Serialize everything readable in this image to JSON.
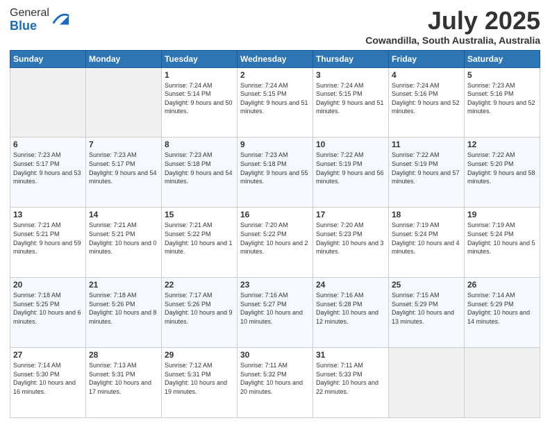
{
  "header": {
    "logo_general": "General",
    "logo_blue": "Blue",
    "main_title": "July 2025",
    "subtitle": "Cowandilla, South Australia, Australia"
  },
  "days_of_week": [
    "Sunday",
    "Monday",
    "Tuesday",
    "Wednesday",
    "Thursday",
    "Friday",
    "Saturday"
  ],
  "weeks": [
    [
      {
        "day": "",
        "info": ""
      },
      {
        "day": "",
        "info": ""
      },
      {
        "day": "1",
        "info": "Sunrise: 7:24 AM\nSunset: 5:14 PM\nDaylight: 9 hours and 50 minutes."
      },
      {
        "day": "2",
        "info": "Sunrise: 7:24 AM\nSunset: 5:15 PM\nDaylight: 9 hours and 51 minutes."
      },
      {
        "day": "3",
        "info": "Sunrise: 7:24 AM\nSunset: 5:15 PM\nDaylight: 9 hours and 51 minutes."
      },
      {
        "day": "4",
        "info": "Sunrise: 7:24 AM\nSunset: 5:16 PM\nDaylight: 9 hours and 52 minutes."
      },
      {
        "day": "5",
        "info": "Sunrise: 7:23 AM\nSunset: 5:16 PM\nDaylight: 9 hours and 52 minutes."
      }
    ],
    [
      {
        "day": "6",
        "info": "Sunrise: 7:23 AM\nSunset: 5:17 PM\nDaylight: 9 hours and 53 minutes."
      },
      {
        "day": "7",
        "info": "Sunrise: 7:23 AM\nSunset: 5:17 PM\nDaylight: 9 hours and 54 minutes."
      },
      {
        "day": "8",
        "info": "Sunrise: 7:23 AM\nSunset: 5:18 PM\nDaylight: 9 hours and 54 minutes."
      },
      {
        "day": "9",
        "info": "Sunrise: 7:23 AM\nSunset: 5:18 PM\nDaylight: 9 hours and 55 minutes."
      },
      {
        "day": "10",
        "info": "Sunrise: 7:22 AM\nSunset: 5:19 PM\nDaylight: 9 hours and 56 minutes."
      },
      {
        "day": "11",
        "info": "Sunrise: 7:22 AM\nSunset: 5:19 PM\nDaylight: 9 hours and 57 minutes."
      },
      {
        "day": "12",
        "info": "Sunrise: 7:22 AM\nSunset: 5:20 PM\nDaylight: 9 hours and 58 minutes."
      }
    ],
    [
      {
        "day": "13",
        "info": "Sunrise: 7:21 AM\nSunset: 5:21 PM\nDaylight: 9 hours and 59 minutes."
      },
      {
        "day": "14",
        "info": "Sunrise: 7:21 AM\nSunset: 5:21 PM\nDaylight: 10 hours and 0 minutes."
      },
      {
        "day": "15",
        "info": "Sunrise: 7:21 AM\nSunset: 5:22 PM\nDaylight: 10 hours and 1 minute."
      },
      {
        "day": "16",
        "info": "Sunrise: 7:20 AM\nSunset: 5:22 PM\nDaylight: 10 hours and 2 minutes."
      },
      {
        "day": "17",
        "info": "Sunrise: 7:20 AM\nSunset: 5:23 PM\nDaylight: 10 hours and 3 minutes."
      },
      {
        "day": "18",
        "info": "Sunrise: 7:19 AM\nSunset: 5:24 PM\nDaylight: 10 hours and 4 minutes."
      },
      {
        "day": "19",
        "info": "Sunrise: 7:19 AM\nSunset: 5:24 PM\nDaylight: 10 hours and 5 minutes."
      }
    ],
    [
      {
        "day": "20",
        "info": "Sunrise: 7:18 AM\nSunset: 5:25 PM\nDaylight: 10 hours and 6 minutes."
      },
      {
        "day": "21",
        "info": "Sunrise: 7:18 AM\nSunset: 5:26 PM\nDaylight: 10 hours and 8 minutes."
      },
      {
        "day": "22",
        "info": "Sunrise: 7:17 AM\nSunset: 5:26 PM\nDaylight: 10 hours and 9 minutes."
      },
      {
        "day": "23",
        "info": "Sunrise: 7:16 AM\nSunset: 5:27 PM\nDaylight: 10 hours and 10 minutes."
      },
      {
        "day": "24",
        "info": "Sunrise: 7:16 AM\nSunset: 5:28 PM\nDaylight: 10 hours and 12 minutes."
      },
      {
        "day": "25",
        "info": "Sunrise: 7:15 AM\nSunset: 5:29 PM\nDaylight: 10 hours and 13 minutes."
      },
      {
        "day": "26",
        "info": "Sunrise: 7:14 AM\nSunset: 5:29 PM\nDaylight: 10 hours and 14 minutes."
      }
    ],
    [
      {
        "day": "27",
        "info": "Sunrise: 7:14 AM\nSunset: 5:30 PM\nDaylight: 10 hours and 16 minutes."
      },
      {
        "day": "28",
        "info": "Sunrise: 7:13 AM\nSunset: 5:31 PM\nDaylight: 10 hours and 17 minutes."
      },
      {
        "day": "29",
        "info": "Sunrise: 7:12 AM\nSunset: 5:31 PM\nDaylight: 10 hours and 19 minutes."
      },
      {
        "day": "30",
        "info": "Sunrise: 7:11 AM\nSunset: 5:32 PM\nDaylight: 10 hours and 20 minutes."
      },
      {
        "day": "31",
        "info": "Sunrise: 7:11 AM\nSunset: 5:33 PM\nDaylight: 10 hours and 22 minutes."
      },
      {
        "day": "",
        "info": ""
      },
      {
        "day": "",
        "info": ""
      }
    ]
  ]
}
